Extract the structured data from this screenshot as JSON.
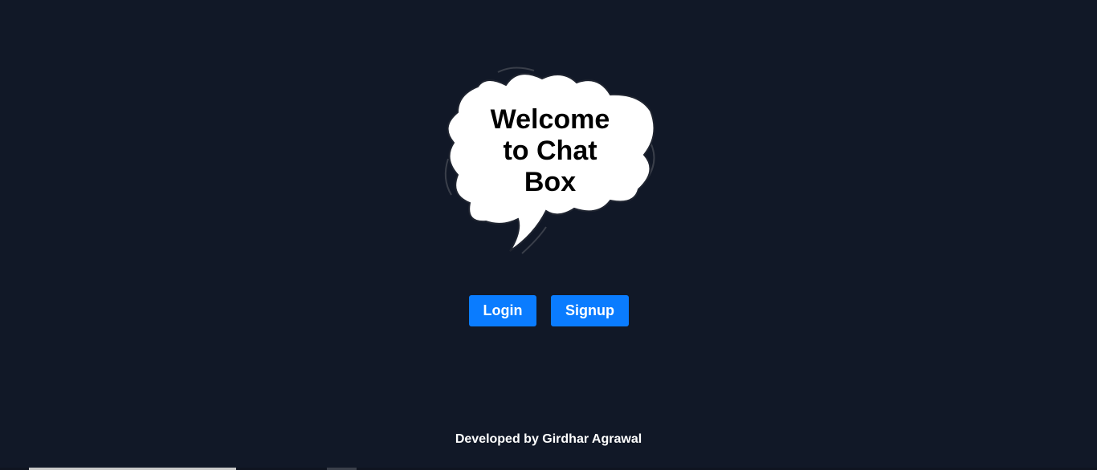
{
  "hero": {
    "line1": "Welcome",
    "line2": "to Chat",
    "line3": "Box"
  },
  "actions": {
    "login_label": "Login",
    "signup_label": "Signup"
  },
  "footer": {
    "credit": "Developed by Girdhar Agrawal"
  },
  "colors": {
    "background": "#111827",
    "button": "#0a7cff",
    "bubble_fill": "#ffffff",
    "text_dark": "#000000",
    "text_light": "#ffffff"
  },
  "icons": {
    "hero": "speech-bubble-icon"
  }
}
